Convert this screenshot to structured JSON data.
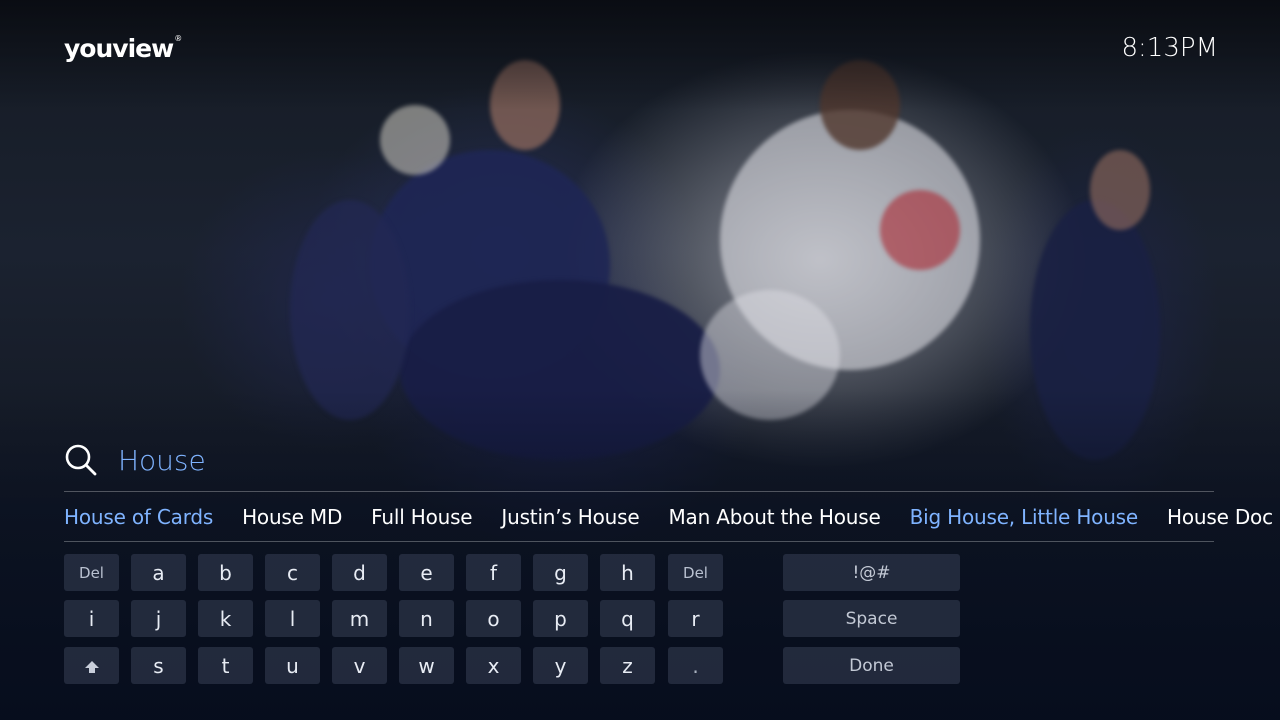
{
  "app": {
    "logo": "youview",
    "clock": "8:13PM"
  },
  "search": {
    "query": "House"
  },
  "results": [
    {
      "label": "House of Cards",
      "state": "selected"
    },
    {
      "label": "House MD",
      "state": "normal"
    },
    {
      "label": "Full House",
      "state": "normal"
    },
    {
      "label": "Justin’s House",
      "state": "normal"
    },
    {
      "label": "Man About the House",
      "state": "normal"
    },
    {
      "label": "Big House, Little House",
      "state": "highlight"
    },
    {
      "label": "House Doc",
      "state": "normal"
    }
  ],
  "keyboard": {
    "row1": [
      "Del",
      "a",
      "b",
      "c",
      "d",
      "e",
      "f",
      "g",
      "h",
      "Del"
    ],
    "row2": [
      "i",
      "j",
      "k",
      "l",
      "m",
      "n",
      "o",
      "p",
      "q",
      "r"
    ],
    "row3_letters": [
      "s",
      "t",
      "u",
      "v",
      "w",
      "x",
      "y",
      "z",
      "."
    ],
    "symbols": "!@#",
    "space": "Space",
    "done": "Done"
  },
  "colors": {
    "accent": "#7fb3ff",
    "key_bg": "#2c3448",
    "text": "#ffffff"
  }
}
